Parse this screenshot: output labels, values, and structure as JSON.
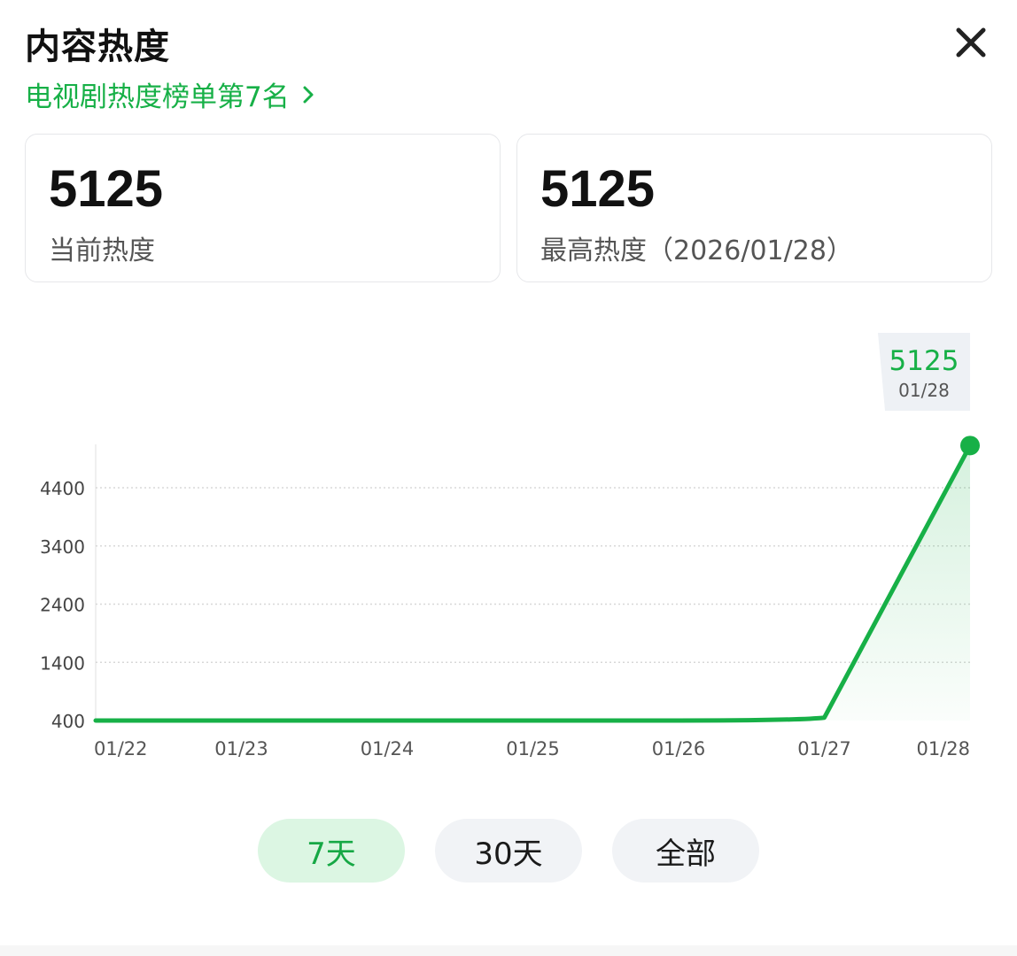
{
  "header": {
    "title": "内容热度",
    "rank_link": "电视剧热度榜单第7名",
    "close_icon": "close-icon",
    "chevron_icon": "chevron-right-icon"
  },
  "stats": {
    "current": {
      "value": "5125",
      "label": "当前热度"
    },
    "peak": {
      "value": "5125",
      "label": "最高热度（2026/01/28）"
    }
  },
  "colors": {
    "accent": "#17b047",
    "accent_light": "#dcf6e3",
    "grid": "#d8d8d8",
    "tooltip_bg": "#eef1f5"
  },
  "chart_data": {
    "type": "area",
    "x": [
      "01/22",
      "01/23",
      "01/24",
      "01/25",
      "01/26",
      "01/27",
      "01/28"
    ],
    "values": [
      400,
      400,
      400,
      400,
      400,
      450,
      5125
    ],
    "y_ticks": [
      400,
      1400,
      2400,
      3400,
      4400
    ],
    "ylim": [
      400,
      5125
    ],
    "grid": true,
    "tooltip": {
      "value": "5125",
      "date": "01/28"
    }
  },
  "tabs": [
    {
      "label": "7天",
      "active": true
    },
    {
      "label": "30天",
      "active": false
    },
    {
      "label": "全部",
      "active": false
    }
  ]
}
